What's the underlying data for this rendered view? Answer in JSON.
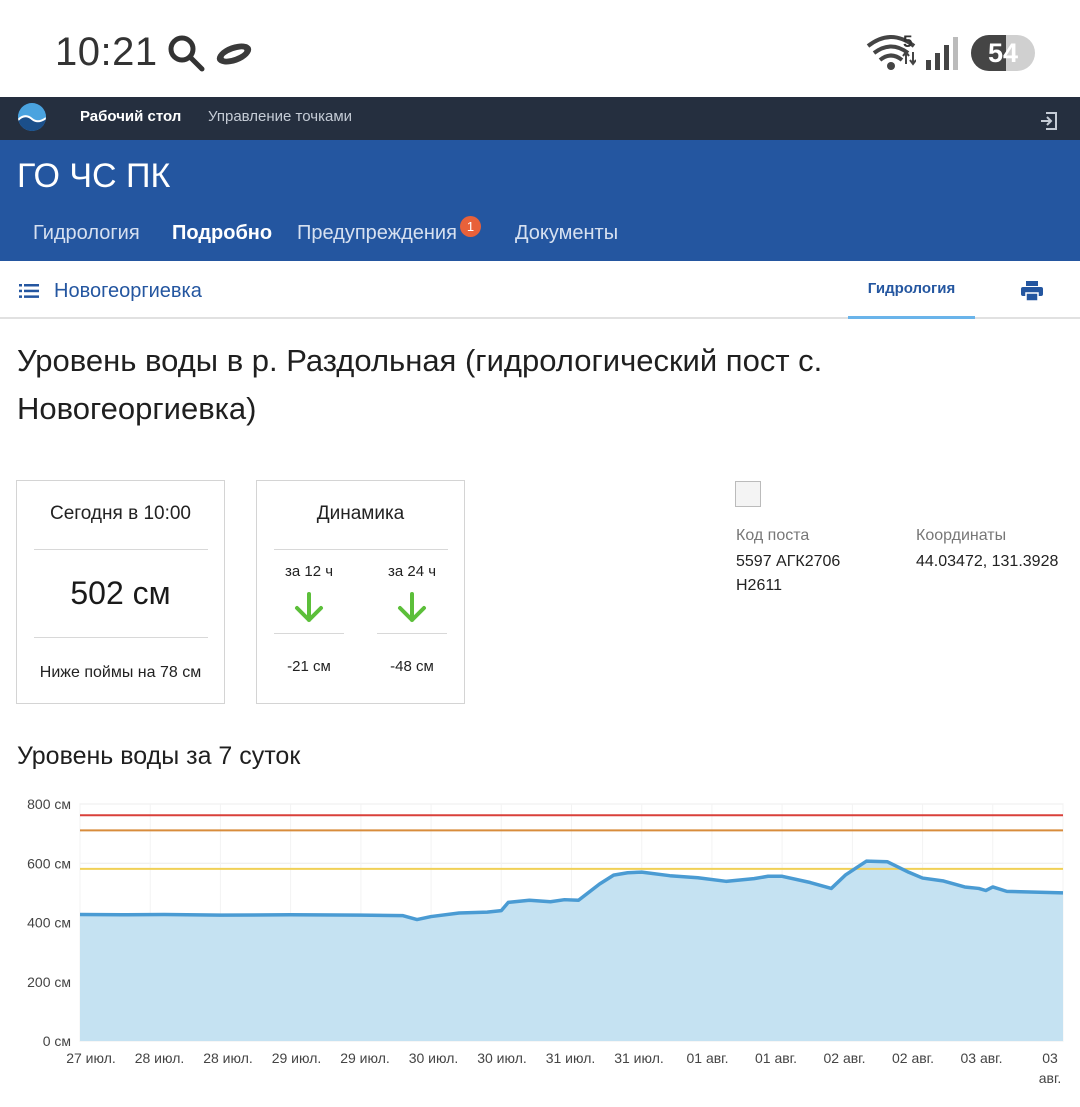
{
  "status_bar": {
    "time": "10:21",
    "wifi_badge": "5",
    "battery": "54",
    "battery_level": 0.54
  },
  "top_nav": {
    "items": [
      "Рабочий стол",
      "Управление точками"
    ],
    "active_index": 0
  },
  "header": {
    "title": "ГО ЧС ПК",
    "tabs": [
      {
        "label": "Гидрология"
      },
      {
        "label": "Подробно"
      },
      {
        "label": "Предупреждения",
        "badge": "1"
      },
      {
        "label": "Документы"
      }
    ],
    "active_tab": "Подробно"
  },
  "location_bar": {
    "location": "Новогеоргиевка",
    "tab": "Гидрология"
  },
  "page_title": "Уровень воды в р. Раздольная (гидрологический пост с. Новогеоргиевка)",
  "today_card": {
    "title": "Сегодня в 10:00",
    "value": "502 см",
    "note": "Ниже поймы на 78 см"
  },
  "dynamics_card": {
    "title": "Динамика",
    "columns": [
      {
        "label": "за 12 ч",
        "value": "-21 см",
        "direction": "down"
      },
      {
        "label": "за 24 ч",
        "value": "-48 см",
        "direction": "down"
      }
    ]
  },
  "post_info": {
    "code_label": "Код поста",
    "code_value_line1": "5597 АГК2706",
    "code_value_line2": "Н2611",
    "coords_label": "Координаты",
    "coords_value": "44.03472, 131.3928"
  },
  "chart_title": "Уровень воды за 7 суток",
  "colors": {
    "header": "#2456a0",
    "top_nav": "#252f3f",
    "series_line": "#4a9bd3",
    "series_fill": "#c5e2f2",
    "arrow": "#5cbf3a",
    "badge": "#e8613a"
  },
  "chart_data": {
    "type": "area",
    "ylim": [
      0,
      800
    ],
    "yticks": [
      "0 см",
      "200 см",
      "400 см",
      "600 см",
      "800 см"
    ],
    "ytick_values": [
      0,
      200,
      400,
      600,
      800
    ],
    "xticks": [
      "27 июл.",
      "28 июл.",
      "28 июл.",
      "29 июл.",
      "29 июл.",
      "30 июл.",
      "30 июл.",
      "31 июл.",
      "31 июл.",
      "01 авг.",
      "01 авг.",
      "02 авг.",
      "02 авг.",
      "03 авг.",
      "03 авг."
    ],
    "x_range": [
      0,
      7
    ],
    "thresholds": [
      {
        "value": 762,
        "color": "#d9403a"
      },
      {
        "value": 711,
        "color": "#d88c3c"
      },
      {
        "value": 581,
        "color": "#f0d056"
      }
    ],
    "series": [
      {
        "x": [
          0,
          0.3,
          0.6,
          1.0,
          1.5,
          2.0,
          2.3,
          2.4,
          2.5,
          2.7,
          2.9,
          3.0,
          3.05,
          3.2,
          3.35,
          3.45,
          3.55,
          3.7,
          3.8,
          3.9,
          4.0,
          4.2,
          4.4,
          4.6,
          4.8,
          4.9,
          5.0,
          5.2,
          5.35,
          5.45,
          5.6,
          5.75,
          5.9,
          6.0,
          6.15,
          6.3,
          6.4,
          6.45,
          6.5,
          6.6,
          7.0
        ],
        "y": [
          427,
          426,
          427,
          425,
          426,
          425,
          423,
          410,
          420,
          432,
          435,
          440,
          468,
          475,
          470,
          477,
          475,
          530,
          560,
          568,
          570,
          558,
          551,
          539,
          548,
          556,
          556,
          535,
          515,
          560,
          607,
          605,
          570,
          550,
          540,
          520,
          515,
          508,
          520,
          505,
          500
        ]
      }
    ]
  }
}
